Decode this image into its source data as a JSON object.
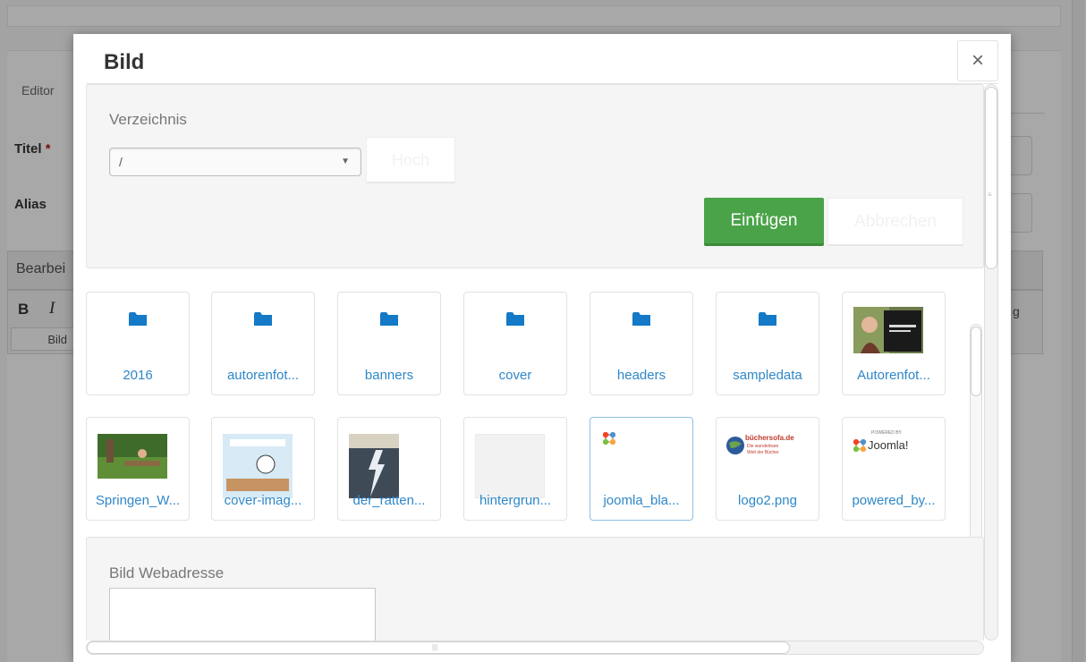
{
  "background": {
    "tab_editor": "Editor",
    "title_label": "Titel",
    "title_required": "*",
    "alias_label": "Alias",
    "bearbeiten_label": "Bearbei",
    "bold_label": "B",
    "italic_label": "I",
    "bild_button": "Bild",
    "right_letter": "g"
  },
  "modal": {
    "title": "Bild",
    "close_symbol": "×",
    "directory_label": "Verzeichnis",
    "directory_value": "/",
    "up_button": "Hoch",
    "insert_button": "Einfügen",
    "cancel_button": "Abbrechen",
    "items": [
      {
        "label": "2016",
        "type": "folder"
      },
      {
        "label": "autorenfot...",
        "type": "folder"
      },
      {
        "label": "banners",
        "type": "folder"
      },
      {
        "label": "cover",
        "type": "folder"
      },
      {
        "label": "headers",
        "type": "folder"
      },
      {
        "label": "sampledata",
        "type": "folder"
      },
      {
        "label": "Autorenfot...",
        "type": "image"
      },
      {
        "label": "Springen_W...",
        "type": "image"
      },
      {
        "label": "cover-imag...",
        "type": "image"
      },
      {
        "label": "der_ratten...",
        "type": "image"
      },
      {
        "label": "hintergrun...",
        "type": "image"
      },
      {
        "label": "joomla_bla...",
        "type": "image"
      },
      {
        "label": "logo2.png",
        "type": "image"
      },
      {
        "label": "powered_by...",
        "type": "image"
      }
    ],
    "thumb_text": {
      "logo2_title": "büchersofa.de",
      "logo2_sub1": "Die wunderbare",
      "logo2_sub2": "Welt der Bücher",
      "powered_small": "POWERED BY",
      "powered_brand": "Joomla!"
    },
    "url_label": "Bild Webadresse",
    "url_value": ""
  },
  "colors": {
    "accent_green": "#4aa348",
    "link_blue": "#2e87c8",
    "folder_blue": "#1479c6"
  }
}
